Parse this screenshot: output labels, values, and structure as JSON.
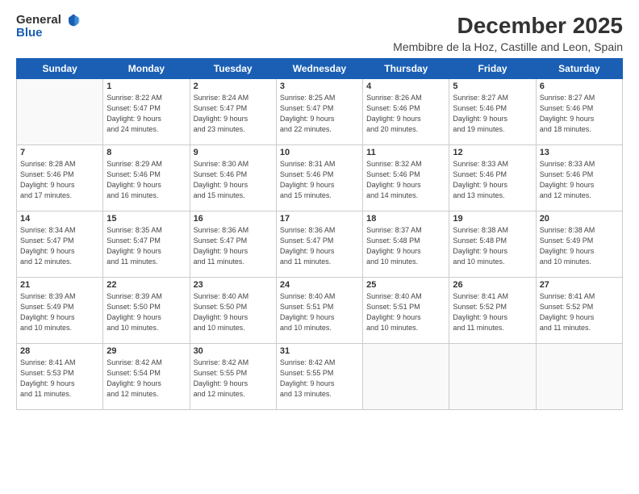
{
  "logo": {
    "line1": "General",
    "line2": "Blue"
  },
  "title": "December 2025",
  "subtitle": "Membibre de la Hoz, Castille and Leon, Spain",
  "weekdays": [
    "Sunday",
    "Monday",
    "Tuesday",
    "Wednesday",
    "Thursday",
    "Friday",
    "Saturday"
  ],
  "weeks": [
    [
      {
        "day": "",
        "info": ""
      },
      {
        "day": "1",
        "info": "Sunrise: 8:22 AM\nSunset: 5:47 PM\nDaylight: 9 hours\nand 24 minutes."
      },
      {
        "day": "2",
        "info": "Sunrise: 8:24 AM\nSunset: 5:47 PM\nDaylight: 9 hours\nand 23 minutes."
      },
      {
        "day": "3",
        "info": "Sunrise: 8:25 AM\nSunset: 5:47 PM\nDaylight: 9 hours\nand 22 minutes."
      },
      {
        "day": "4",
        "info": "Sunrise: 8:26 AM\nSunset: 5:46 PM\nDaylight: 9 hours\nand 20 minutes."
      },
      {
        "day": "5",
        "info": "Sunrise: 8:27 AM\nSunset: 5:46 PM\nDaylight: 9 hours\nand 19 minutes."
      },
      {
        "day": "6",
        "info": "Sunrise: 8:27 AM\nSunset: 5:46 PM\nDaylight: 9 hours\nand 18 minutes."
      }
    ],
    [
      {
        "day": "7",
        "info": "Sunrise: 8:28 AM\nSunset: 5:46 PM\nDaylight: 9 hours\nand 17 minutes."
      },
      {
        "day": "8",
        "info": "Sunrise: 8:29 AM\nSunset: 5:46 PM\nDaylight: 9 hours\nand 16 minutes."
      },
      {
        "day": "9",
        "info": "Sunrise: 8:30 AM\nSunset: 5:46 PM\nDaylight: 9 hours\nand 15 minutes."
      },
      {
        "day": "10",
        "info": "Sunrise: 8:31 AM\nSunset: 5:46 PM\nDaylight: 9 hours\nand 15 minutes."
      },
      {
        "day": "11",
        "info": "Sunrise: 8:32 AM\nSunset: 5:46 PM\nDaylight: 9 hours\nand 14 minutes."
      },
      {
        "day": "12",
        "info": "Sunrise: 8:33 AM\nSunset: 5:46 PM\nDaylight: 9 hours\nand 13 minutes."
      },
      {
        "day": "13",
        "info": "Sunrise: 8:33 AM\nSunset: 5:46 PM\nDaylight: 9 hours\nand 12 minutes."
      }
    ],
    [
      {
        "day": "14",
        "info": "Sunrise: 8:34 AM\nSunset: 5:47 PM\nDaylight: 9 hours\nand 12 minutes."
      },
      {
        "day": "15",
        "info": "Sunrise: 8:35 AM\nSunset: 5:47 PM\nDaylight: 9 hours\nand 11 minutes."
      },
      {
        "day": "16",
        "info": "Sunrise: 8:36 AM\nSunset: 5:47 PM\nDaylight: 9 hours\nand 11 minutes."
      },
      {
        "day": "17",
        "info": "Sunrise: 8:36 AM\nSunset: 5:47 PM\nDaylight: 9 hours\nand 11 minutes."
      },
      {
        "day": "18",
        "info": "Sunrise: 8:37 AM\nSunset: 5:48 PM\nDaylight: 9 hours\nand 10 minutes."
      },
      {
        "day": "19",
        "info": "Sunrise: 8:38 AM\nSunset: 5:48 PM\nDaylight: 9 hours\nand 10 minutes."
      },
      {
        "day": "20",
        "info": "Sunrise: 8:38 AM\nSunset: 5:49 PM\nDaylight: 9 hours\nand 10 minutes."
      }
    ],
    [
      {
        "day": "21",
        "info": "Sunrise: 8:39 AM\nSunset: 5:49 PM\nDaylight: 9 hours\nand 10 minutes."
      },
      {
        "day": "22",
        "info": "Sunrise: 8:39 AM\nSunset: 5:50 PM\nDaylight: 9 hours\nand 10 minutes."
      },
      {
        "day": "23",
        "info": "Sunrise: 8:40 AM\nSunset: 5:50 PM\nDaylight: 9 hours\nand 10 minutes."
      },
      {
        "day": "24",
        "info": "Sunrise: 8:40 AM\nSunset: 5:51 PM\nDaylight: 9 hours\nand 10 minutes."
      },
      {
        "day": "25",
        "info": "Sunrise: 8:40 AM\nSunset: 5:51 PM\nDaylight: 9 hours\nand 10 minutes."
      },
      {
        "day": "26",
        "info": "Sunrise: 8:41 AM\nSunset: 5:52 PM\nDaylight: 9 hours\nand 11 minutes."
      },
      {
        "day": "27",
        "info": "Sunrise: 8:41 AM\nSunset: 5:52 PM\nDaylight: 9 hours\nand 11 minutes."
      }
    ],
    [
      {
        "day": "28",
        "info": "Sunrise: 8:41 AM\nSunset: 5:53 PM\nDaylight: 9 hours\nand 11 minutes."
      },
      {
        "day": "29",
        "info": "Sunrise: 8:42 AM\nSunset: 5:54 PM\nDaylight: 9 hours\nand 12 minutes."
      },
      {
        "day": "30",
        "info": "Sunrise: 8:42 AM\nSunset: 5:55 PM\nDaylight: 9 hours\nand 12 minutes."
      },
      {
        "day": "31",
        "info": "Sunrise: 8:42 AM\nSunset: 5:55 PM\nDaylight: 9 hours\nand 13 minutes."
      },
      {
        "day": "",
        "info": ""
      },
      {
        "day": "",
        "info": ""
      },
      {
        "day": "",
        "info": ""
      }
    ]
  ]
}
